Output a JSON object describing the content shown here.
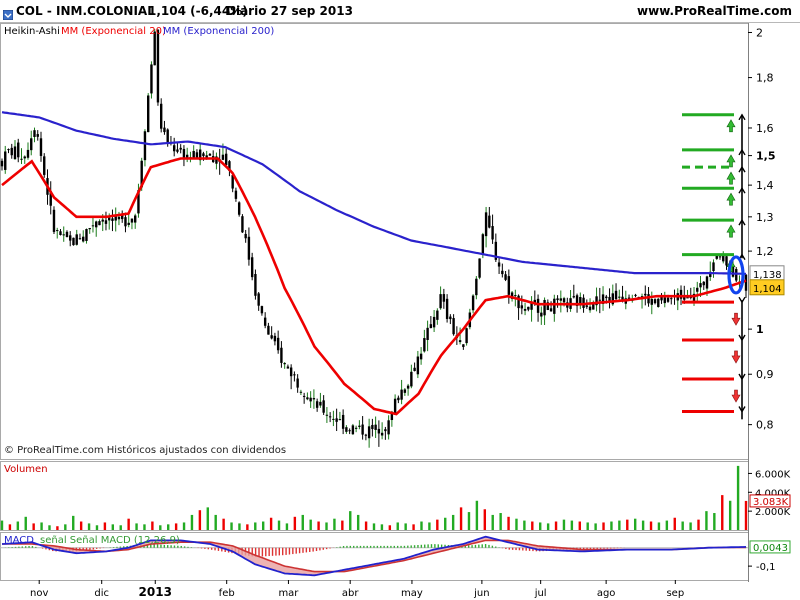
{
  "header": {
    "symbol": "COL - INM.COLONIAL",
    "last": "1,104 (-6,44%)",
    "period_date": "Diario  27 sep 2013",
    "site": "www.ProRealTime.com"
  },
  "colors": {
    "candle": "#000000",
    "ema20": "#ee0000",
    "ema200": "#2a22cc",
    "up_level": "#22aa22",
    "down_level": "#ee0000",
    "volume_up": "#22aa22",
    "volume_down": "#ee0000",
    "macd_line": "#2222cc",
    "signal_line": "#cc3333",
    "highlight_ellipse": "#1144ee"
  },
  "chart_data": [
    {
      "type": "candlestick",
      "panel": "price",
      "title": "Heikin-Ashi",
      "legend": [
        "Heikin-Ashi",
        "MM (Exponencial 20)",
        "MM (Exponencial 200)"
      ],
      "x_tick_labels": [
        "nov",
        "dic",
        "2013",
        "feb",
        "mar",
        "abr",
        "may",
        "jun",
        "jul",
        "ago",
        "sep"
      ],
      "y_tick_labels": [
        "2",
        "1,8",
        "1,6",
        "1,5",
        "1,4",
        "1,3",
        "1,2",
        "1",
        "0,9",
        "0,8"
      ],
      "ylim": [
        0.74,
        2.04
      ],
      "scale": "log",
      "price_path": [
        [
          0,
          1.48
        ],
        [
          0.01,
          1.52
        ],
        [
          0.03,
          1.5
        ],
        [
          0.045,
          1.62
        ],
        [
          0.055,
          1.46
        ],
        [
          0.07,
          1.26
        ],
        [
          0.09,
          1.22
        ],
        [
          0.11,
          1.25
        ],
        [
          0.13,
          1.3
        ],
        [
          0.16,
          1.28
        ],
        [
          0.18,
          1.31
        ],
        [
          0.19,
          1.55
        ],
        [
          0.2,
          1.82
        ],
        [
          0.205,
          2.04
        ],
        [
          0.21,
          1.65
        ],
        [
          0.22,
          1.55
        ],
        [
          0.25,
          1.5
        ],
        [
          0.28,
          1.5
        ],
        [
          0.3,
          1.5
        ],
        [
          0.31,
          1.4
        ],
        [
          0.32,
          1.3
        ],
        [
          0.33,
          1.2
        ],
        [
          0.345,
          1.05
        ],
        [
          0.36,
          0.98
        ],
        [
          0.38,
          0.92
        ],
        [
          0.4,
          0.88
        ],
        [
          0.42,
          0.84
        ],
        [
          0.44,
          0.82
        ],
        [
          0.46,
          0.8
        ],
        [
          0.48,
          0.79
        ],
        [
          0.5,
          0.79
        ],
        [
          0.52,
          0.8
        ],
        [
          0.53,
          0.85
        ],
        [
          0.55,
          0.9
        ],
        [
          0.57,
          0.98
        ],
        [
          0.59,
          1.08
        ],
        [
          0.6,
          1.02
        ],
        [
          0.62,
          0.95
        ],
        [
          0.635,
          1.1
        ],
        [
          0.65,
          1.3
        ],
        [
          0.665,
          1.18
        ],
        [
          0.68,
          1.1
        ],
        [
          0.7,
          1.05
        ],
        [
          0.75,
          1.06
        ],
        [
          0.8,
          1.07
        ],
        [
          0.85,
          1.09
        ],
        [
          0.88,
          1.06
        ],
        [
          0.91,
          1.08
        ],
        [
          0.94,
          1.1
        ],
        [
          0.96,
          1.2
        ],
        [
          0.975,
          1.16
        ],
        [
          0.985,
          1.14
        ],
        [
          1.0,
          1.104
        ]
      ],
      "candle_count": 230
    },
    {
      "type": "line",
      "panel": "price",
      "series": [
        {
          "name": "MM (Exponencial 20)",
          "points": [
            [
              0,
              1.4
            ],
            [
              0.04,
              1.48
            ],
            [
              0.07,
              1.36
            ],
            [
              0.1,
              1.3
            ],
            [
              0.14,
              1.3
            ],
            [
              0.17,
              1.31
            ],
            [
              0.2,
              1.46
            ],
            [
              0.24,
              1.49
            ],
            [
              0.29,
              1.49
            ],
            [
              0.31,
              1.44
            ],
            [
              0.34,
              1.3
            ],
            [
              0.38,
              1.1
            ],
            [
              0.42,
              0.96
            ],
            [
              0.46,
              0.88
            ],
            [
              0.5,
              0.83
            ],
            [
              0.53,
              0.82
            ],
            [
              0.56,
              0.86
            ],
            [
              0.59,
              0.94
            ],
            [
              0.62,
              1.0
            ],
            [
              0.65,
              1.07
            ],
            [
              0.68,
              1.08
            ],
            [
              0.72,
              1.06
            ],
            [
              0.78,
              1.06
            ],
            [
              0.84,
              1.07
            ],
            [
              0.88,
              1.08
            ],
            [
              0.93,
              1.08
            ],
            [
              0.97,
              1.1
            ],
            [
              1.0,
              1.12
            ]
          ]
        },
        {
          "name": "MM (Exponencial 200)",
          "points": [
            [
              0,
              1.66
            ],
            [
              0.05,
              1.64
            ],
            [
              0.1,
              1.59
            ],
            [
              0.15,
              1.56
            ],
            [
              0.2,
              1.54
            ],
            [
              0.25,
              1.55
            ],
            [
              0.3,
              1.53
            ],
            [
              0.35,
              1.47
            ],
            [
              0.4,
              1.38
            ],
            [
              0.45,
              1.32
            ],
            [
              0.5,
              1.27
            ],
            [
              0.55,
              1.23
            ],
            [
              0.6,
              1.21
            ],
            [
              0.65,
              1.19
            ],
            [
              0.7,
              1.17
            ],
            [
              0.75,
              1.16
            ],
            [
              0.8,
              1.15
            ],
            [
              0.85,
              1.14
            ],
            [
              0.9,
              1.14
            ],
            [
              0.95,
              1.14
            ],
            [
              1.0,
              1.138
            ]
          ]
        }
      ]
    },
    {
      "type": "annotations",
      "panel": "price",
      "price_labels": [
        "1,138",
        "1,104"
      ],
      "up_levels": [
        1.19,
        1.29,
        1.39,
        1.46,
        1.52,
        1.65
      ],
      "up_level_styles": [
        "solid",
        "solid",
        "solid",
        "dashed",
        "solid",
        "solid"
      ],
      "down_levels": [
        1.065,
        0.975,
        0.89,
        0.825
      ],
      "footer": "© ProRealTime.com  Históricos ajustados con dividendos"
    },
    {
      "type": "bar",
      "panel": "volume",
      "title": "Volumen",
      "y_tick_labels": [
        "6.000K",
        "4.000K",
        "2.000K"
      ],
      "last_label": "3.083K",
      "values": [
        1000,
        600,
        900,
        1400,
        700,
        800,
        500,
        400,
        600,
        1500,
        900,
        700,
        500,
        800,
        600,
        500,
        1200,
        700,
        600,
        900,
        500,
        600,
        700,
        800,
        1600,
        2100,
        2400,
        1600,
        1200,
        800,
        700,
        600,
        800,
        900,
        1300,
        1000,
        700,
        1400,
        1600,
        1100,
        900,
        800,
        1200,
        1000,
        2000,
        1600,
        900,
        700,
        600,
        500,
        800,
        700,
        600,
        900,
        800,
        1100,
        1300,
        1600,
        2400,
        1900,
        3100,
        2200,
        1600,
        1800,
        1400,
        1200,
        1000,
        900,
        800,
        700,
        900,
        1100,
        1000,
        900,
        800,
        700,
        800,
        900,
        1000,
        1100,
        1200,
        1000,
        900,
        800,
        1000,
        1300,
        900,
        800,
        1100,
        2000,
        1800,
        3700,
        3100,
        6800,
        3083
      ],
      "colors": "mixed"
    },
    {
      "type": "line",
      "panel": "macd",
      "title": "MACD",
      "legend": [
        "MACD",
        "señal Señal MACD (12,26,9)"
      ],
      "y_tick_labels": [
        "0,0043",
        "-0,1"
      ],
      "series": [
        {
          "name": "MACD",
          "points": [
            [
              0,
              0.02
            ],
            [
              0.04,
              0.03
            ],
            [
              0.07,
              -0.01
            ],
            [
              0.1,
              -0.03
            ],
            [
              0.14,
              -0.02
            ],
            [
              0.17,
              0.0
            ],
            [
              0.2,
              0.04
            ],
            [
              0.24,
              0.04
            ],
            [
              0.28,
              0.02
            ],
            [
              0.31,
              -0.02
            ],
            [
              0.34,
              -0.09
            ],
            [
              0.38,
              -0.14
            ],
            [
              0.42,
              -0.15
            ],
            [
              0.46,
              -0.12
            ],
            [
              0.5,
              -0.09
            ],
            [
              0.54,
              -0.06
            ],
            [
              0.58,
              -0.01
            ],
            [
              0.62,
              0.02
            ],
            [
              0.65,
              0.06
            ],
            [
              0.68,
              0.03
            ],
            [
              0.72,
              -0.01
            ],
            [
              0.78,
              -0.02
            ],
            [
              0.84,
              -0.01
            ],
            [
              0.9,
              -0.01
            ],
            [
              0.95,
              0.0
            ],
            [
              1.0,
              0.0043
            ]
          ]
        },
        {
          "name": "señal Señal MACD (12,26,9)",
          "points": [
            [
              0,
              0.02
            ],
            [
              0.04,
              0.02
            ],
            [
              0.07,
              0.01
            ],
            [
              0.1,
              -0.01
            ],
            [
              0.14,
              -0.02
            ],
            [
              0.17,
              -0.01
            ],
            [
              0.2,
              0.02
            ],
            [
              0.24,
              0.03
            ],
            [
              0.28,
              0.03
            ],
            [
              0.31,
              0.01
            ],
            [
              0.34,
              -0.04
            ],
            [
              0.38,
              -0.1
            ],
            [
              0.42,
              -0.13
            ],
            [
              0.46,
              -0.13
            ],
            [
              0.5,
              -0.1
            ],
            [
              0.54,
              -0.07
            ],
            [
              0.58,
              -0.03
            ],
            [
              0.62,
              0.01
            ],
            [
              0.65,
              0.04
            ],
            [
              0.68,
              0.04
            ],
            [
              0.72,
              0.01
            ],
            [
              0.78,
              -0.01
            ],
            [
              0.84,
              -0.01
            ],
            [
              0.9,
              -0.01
            ],
            [
              0.95,
              0.0
            ],
            [
              1.0,
              0.002
            ]
          ]
        }
      ]
    }
  ]
}
